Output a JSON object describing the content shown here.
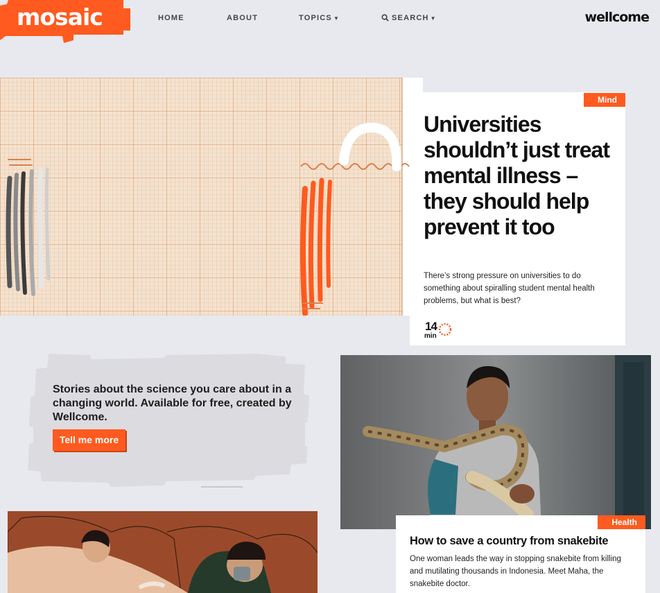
{
  "header": {
    "logo": "mosaic",
    "nav": {
      "home": "HOME",
      "about": "ABOUT",
      "topics": "TOPICS",
      "search": "SEARCH"
    },
    "brand": "wellcome",
    "icons": [
      "search-icon",
      "chevron-down-icon"
    ]
  },
  "hero": {
    "tag": "Mind",
    "title": "Universities shouldn’t just treat mental illness – they should help prevent it too",
    "description": "There’s strong pressure on universities to do something about spiralling student mental health problems, but what is best?",
    "read_time": "14",
    "read_time_unit": "min"
  },
  "promo": {
    "text": "Stories about the science you care about in a changing world. Available for free, created by Wellcome.",
    "button": "Tell me more"
  },
  "story_snakebite": {
    "tag": "Health",
    "title": "How to save a country from snakebite",
    "description": "One woman leads the way in stopping snakebite from killing and mutilating thousands in Indonesia. Meet Maha, the snakebite doctor."
  },
  "colors": {
    "accent": "#ff5a1f",
    "background": "#e8e9ee",
    "card": "#ffffff",
    "grid_paper": "#f0d8be",
    "illustration_brown": "#9a4a2a"
  }
}
